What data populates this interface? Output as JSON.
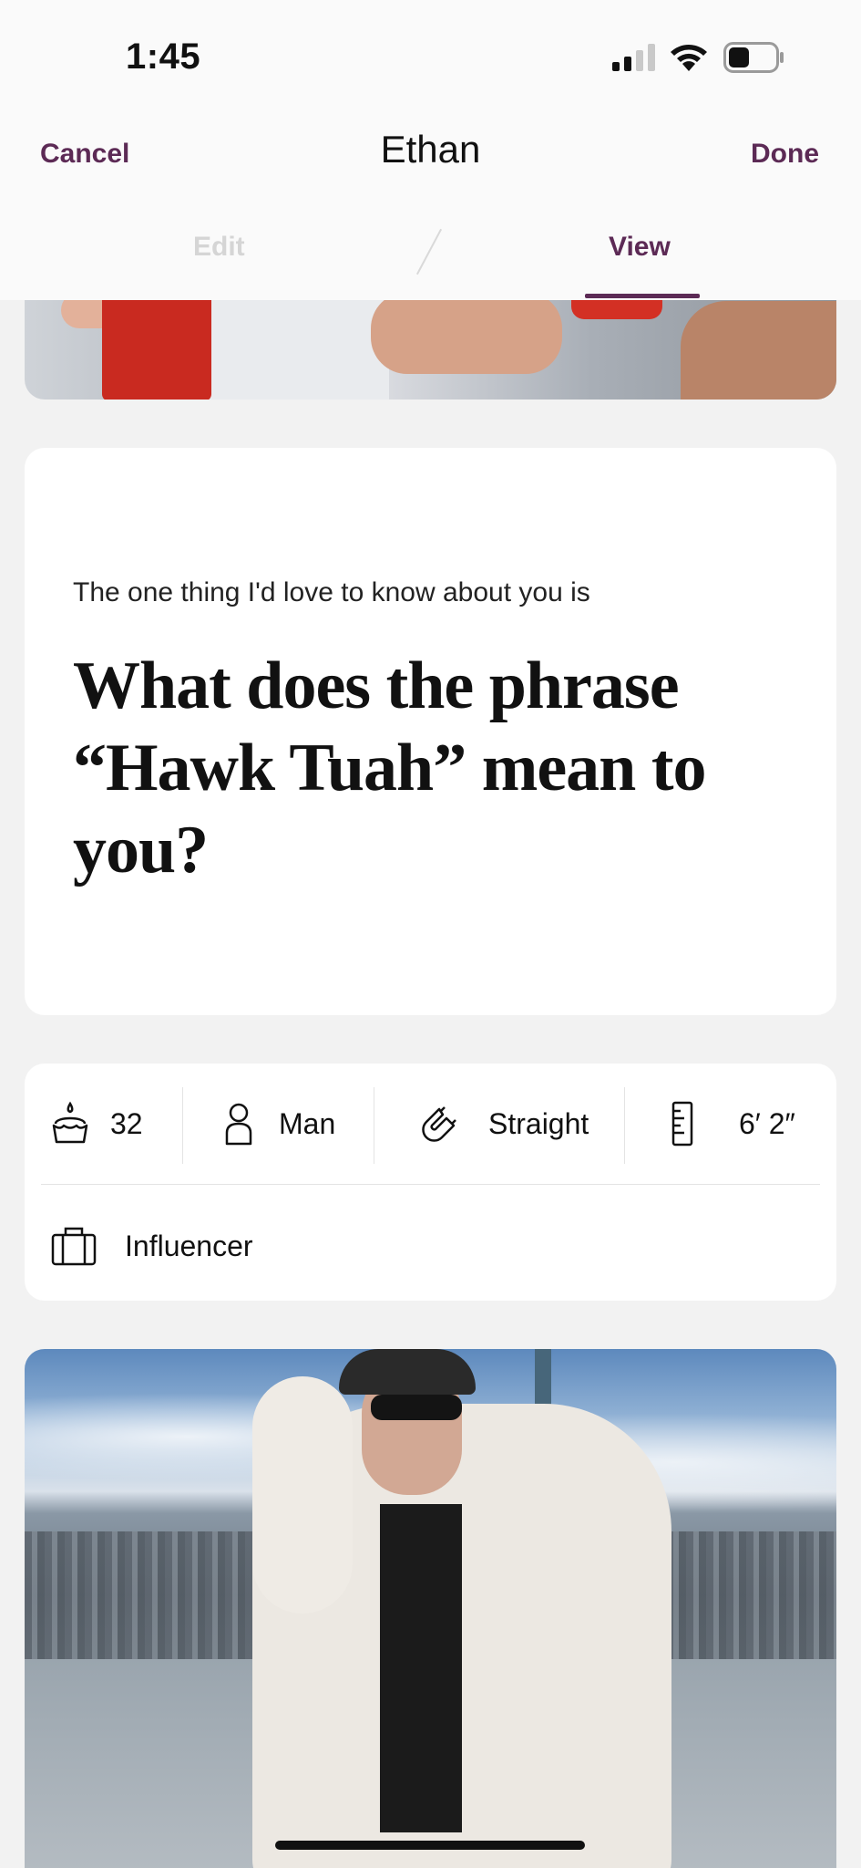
{
  "status_bar": {
    "time": "1:45",
    "signal_icon": "cellular-signal-icon",
    "wifi_icon": "wifi-icon",
    "battery_icon": "battery-icon"
  },
  "nav": {
    "cancel_label": "Cancel",
    "title": "Ethan",
    "done_label": "Done"
  },
  "tabs": [
    {
      "label": "Edit",
      "active": false
    },
    {
      "label": "View",
      "active": true
    }
  ],
  "prompt": {
    "label": "The one thing I'd love to know about you is",
    "answer": "What does the phrase “Hawk Tuah” mean to you?"
  },
  "info": {
    "age": "32",
    "gender": "Man",
    "orientation": "Straight",
    "height": "6′ 2″",
    "job": "Influencer",
    "icons": [
      "birthday-cake-icon",
      "person-icon",
      "magnet-icon",
      "ruler-icon",
      "briefcase-icon"
    ]
  },
  "colors": {
    "accent": "#5c2a55",
    "background": "#f2f2f2",
    "card": "#ffffff"
  }
}
